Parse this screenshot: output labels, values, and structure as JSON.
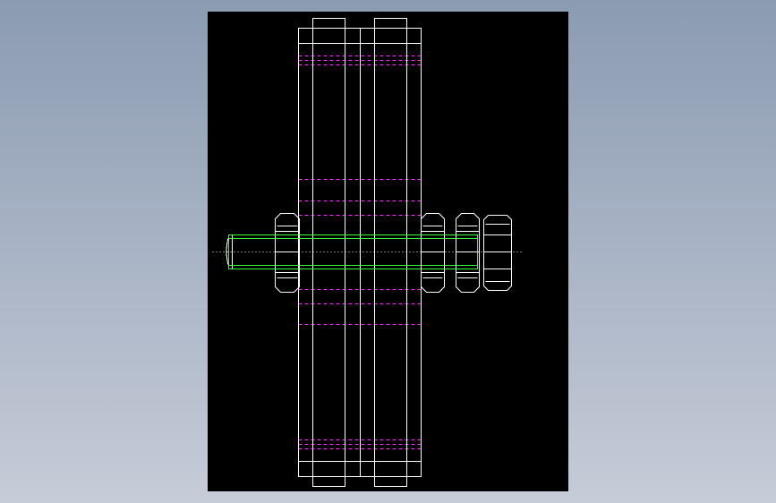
{
  "viewport": {
    "background_top": "#8b9bb2",
    "background_bottom": "#c6ccd8"
  },
  "sheet": {
    "background": "#000000"
  },
  "palette": {
    "outline": "#ffffff",
    "hidden": "#ff33ff",
    "bolt": "#33ff33",
    "centerline": "#ffffff"
  },
  "parts": [
    {
      "name": "washer-plate",
      "kind": "plate"
    },
    {
      "name": "pulley-left",
      "kind": "wheel"
    },
    {
      "name": "spacer-plate",
      "kind": "plate"
    },
    {
      "name": "pulley-right",
      "kind": "wheel"
    },
    {
      "name": "bolt",
      "kind": "threaded-shaft"
    },
    {
      "name": "hex-nut",
      "kind": "nut"
    },
    {
      "name": "bolt-head",
      "kind": "hex-head"
    }
  ]
}
